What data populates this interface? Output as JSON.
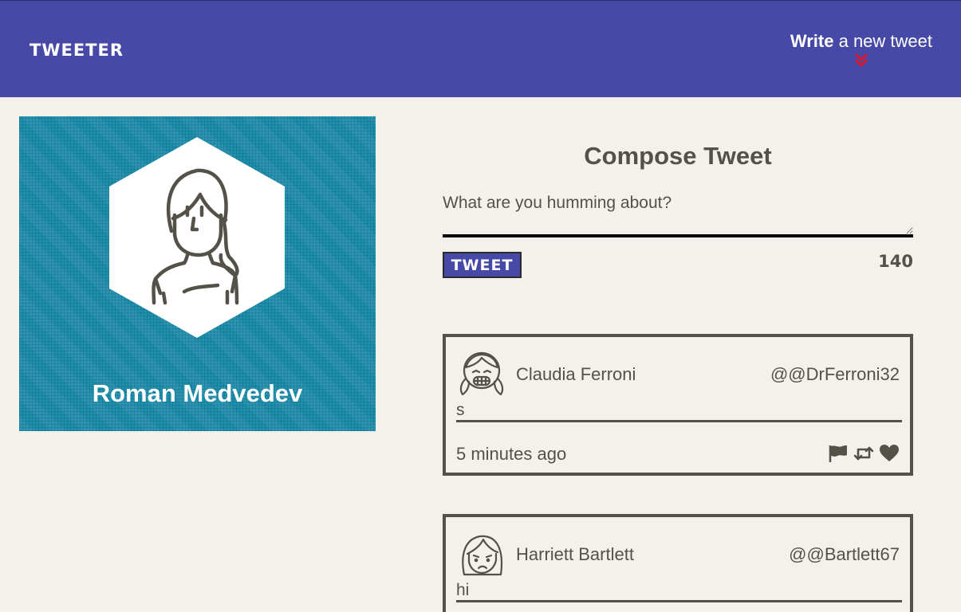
{
  "nav": {
    "logo": "TWEETER",
    "compose_toggle": {
      "strong": "Write",
      "rest": " a new tweet",
      "icon": "double-chevron-down-icon",
      "icon_color": "#e0162b"
    },
    "background": "#4649a5"
  },
  "profile": {
    "name": "Roman Medvedev",
    "avatar_icon": "person-avatar-icon",
    "background": "#1f8fae"
  },
  "composer": {
    "title": "Compose Tweet",
    "placeholder": "What are you humming about?",
    "button_label": "TWEET",
    "char_count": "140"
  },
  "tweets": [
    {
      "name": "Claudia Ferroni",
      "handle": "@@DrFerroni32",
      "text": "s",
      "time": "5 minutes ago",
      "avatar_icon": "girl-laughing-avatar-icon",
      "actions": [
        "flag-icon",
        "retweet-icon",
        "heart-icon"
      ]
    },
    {
      "name": "Harriett Bartlett",
      "handle": "@@Bartlett67",
      "text": "hi",
      "avatar_icon": "woman-frowning-avatar-icon"
    }
  ]
}
